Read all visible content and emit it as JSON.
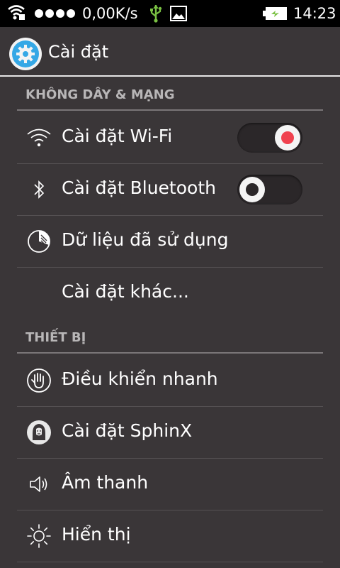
{
  "status_bar": {
    "speed": "0,00K/s",
    "time": "14:23",
    "icons": [
      "wifi-icon",
      "signal-dots-icon",
      "usb-icon",
      "gallery-icon",
      "battery-charging-icon"
    ]
  },
  "action_bar": {
    "title": "Cài đặt",
    "icon": "settings-gear-icon"
  },
  "sections": {
    "wireless": {
      "header": "KHÔNG DÂY & MẠNG",
      "items": [
        {
          "label": "Cài đặt Wi-Fi",
          "icon": "wifi-icon",
          "toggle": "on"
        },
        {
          "label": "Cài đặt Bluetooth",
          "icon": "bluetooth-icon",
          "toggle": "off"
        },
        {
          "label": "Dữ liệu đã sử dụng",
          "icon": "data-usage-icon"
        },
        {
          "label": "Cài đặt khác..."
        }
      ]
    },
    "device": {
      "header": "THIẾT BỊ",
      "items": [
        {
          "label": "Điều khiển nhanh",
          "icon": "hand-icon"
        },
        {
          "label": "Cài đặt SphinX",
          "icon": "sphinx-icon"
        },
        {
          "label": "Âm thanh",
          "icon": "speaker-icon"
        },
        {
          "label": "Hiển thị",
          "icon": "brightness-icon"
        }
      ]
    }
  },
  "colors": {
    "background": "#3a3638",
    "accent_toggle_on": "#f0424f",
    "toggle_off_dot": "#2b2729",
    "settings_icon": "#35a8e6"
  }
}
